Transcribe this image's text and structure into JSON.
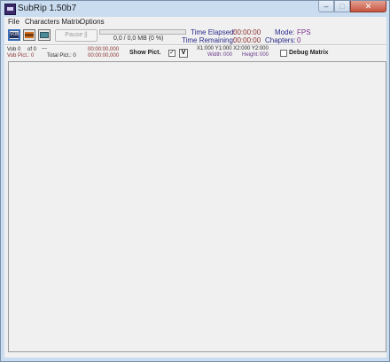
{
  "window": {
    "title": "SubRip 1.50b7",
    "controls": {
      "minimize": "–",
      "maximize": "□",
      "close": "✕"
    }
  },
  "menu": [
    "File",
    "Characters Matrix",
    "Options"
  ],
  "toolbar": {
    "icons": [
      "vob-icon",
      "film-icon",
      "screen-icon"
    ],
    "pause_label": "Pause  ||",
    "progress_fraction": 0,
    "size_text": "0,0 / 0,0 MB (0 %)",
    "time_elapsed_label": "Time Elapsed:",
    "time_elapsed_value": "00:00:00",
    "time_remaining_label": "Time Remaining:",
    "time_remaining_value": "00:00:00",
    "mode_label": "Mode:",
    "mode_value": "FPS",
    "chapters_label": "Chapters:",
    "chapters_value": "0"
  },
  "info": {
    "vob_label": "Vob 0",
    "of_label": "of 0",
    "dashes": "---",
    "vob_pict_label": "Vob Pict.: 0",
    "total_pict_label": "Total Pict.: 0",
    "time1": "00:00:00,000",
    "time2": "00:00:00,000",
    "show_pict_label": "Show Pict.",
    "show_pict_check": "✓",
    "v_button": "V",
    "coords": "X1:000 Y1:000 X2:000 Y2:000",
    "width_label": "Width:",
    "width_value": "000",
    "height_label": "Height:",
    "height_value": "000",
    "debug_matrix_label": "Debug Matrix"
  }
}
